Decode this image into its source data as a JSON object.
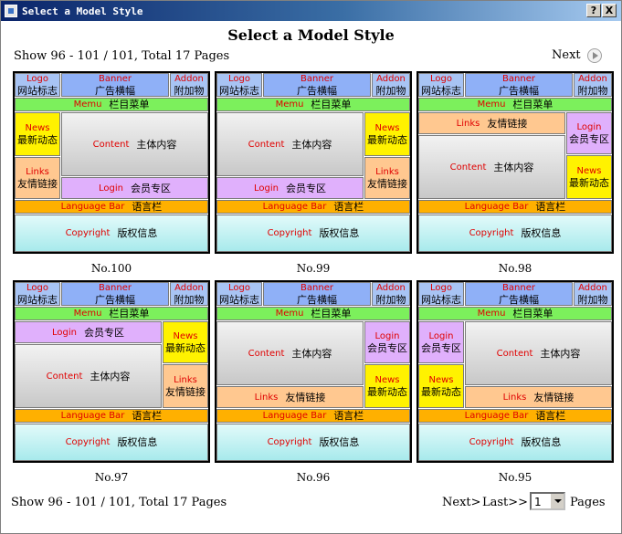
{
  "window": {
    "title": "Select a Model Style",
    "help_label": "?",
    "close_label": "X"
  },
  "page": {
    "title": "Select a Model Style",
    "pager_text": "Show 96 - 101 / 101, Total 17 Pages",
    "next_label": "Next",
    "next_bottom": "Next>",
    "last_bottom": "Last>>",
    "page_value": "1",
    "pages_label": "Pages"
  },
  "labels": {
    "logo_en": "Logo",
    "logo_cn": "网站标志",
    "banner_en": "Banner",
    "banner_cn": "广告横幅",
    "addon_en": "Addon",
    "addon_cn": "附加物",
    "menu_en": "Memu",
    "menu_cn": "栏目菜单",
    "news_en": "News",
    "news_cn": "最新动态",
    "links_en": "Links",
    "links_cn": "友情链接",
    "content_en": "Content",
    "content_cn": "主体内容",
    "login_en": "Login",
    "login_cn": "会员专区",
    "lang_en": "Language Bar",
    "lang_cn": "语言栏",
    "copy_en": "Copyright",
    "copy_cn": "版权信息"
  },
  "models": [
    {
      "caption": "No.100"
    },
    {
      "caption": "No.99"
    },
    {
      "caption": "No.98"
    },
    {
      "caption": "No.97"
    },
    {
      "caption": "No.96"
    },
    {
      "caption": "No.95"
    }
  ],
  "colors": {
    "logo": "#a8c4f4",
    "banner": "#8fb0f7",
    "menu": "#7cf05c",
    "news": "#fff200",
    "links": "#ffc890",
    "login": "#e0b0fc",
    "lang": "#ffb000",
    "label_en": "#e00000"
  }
}
